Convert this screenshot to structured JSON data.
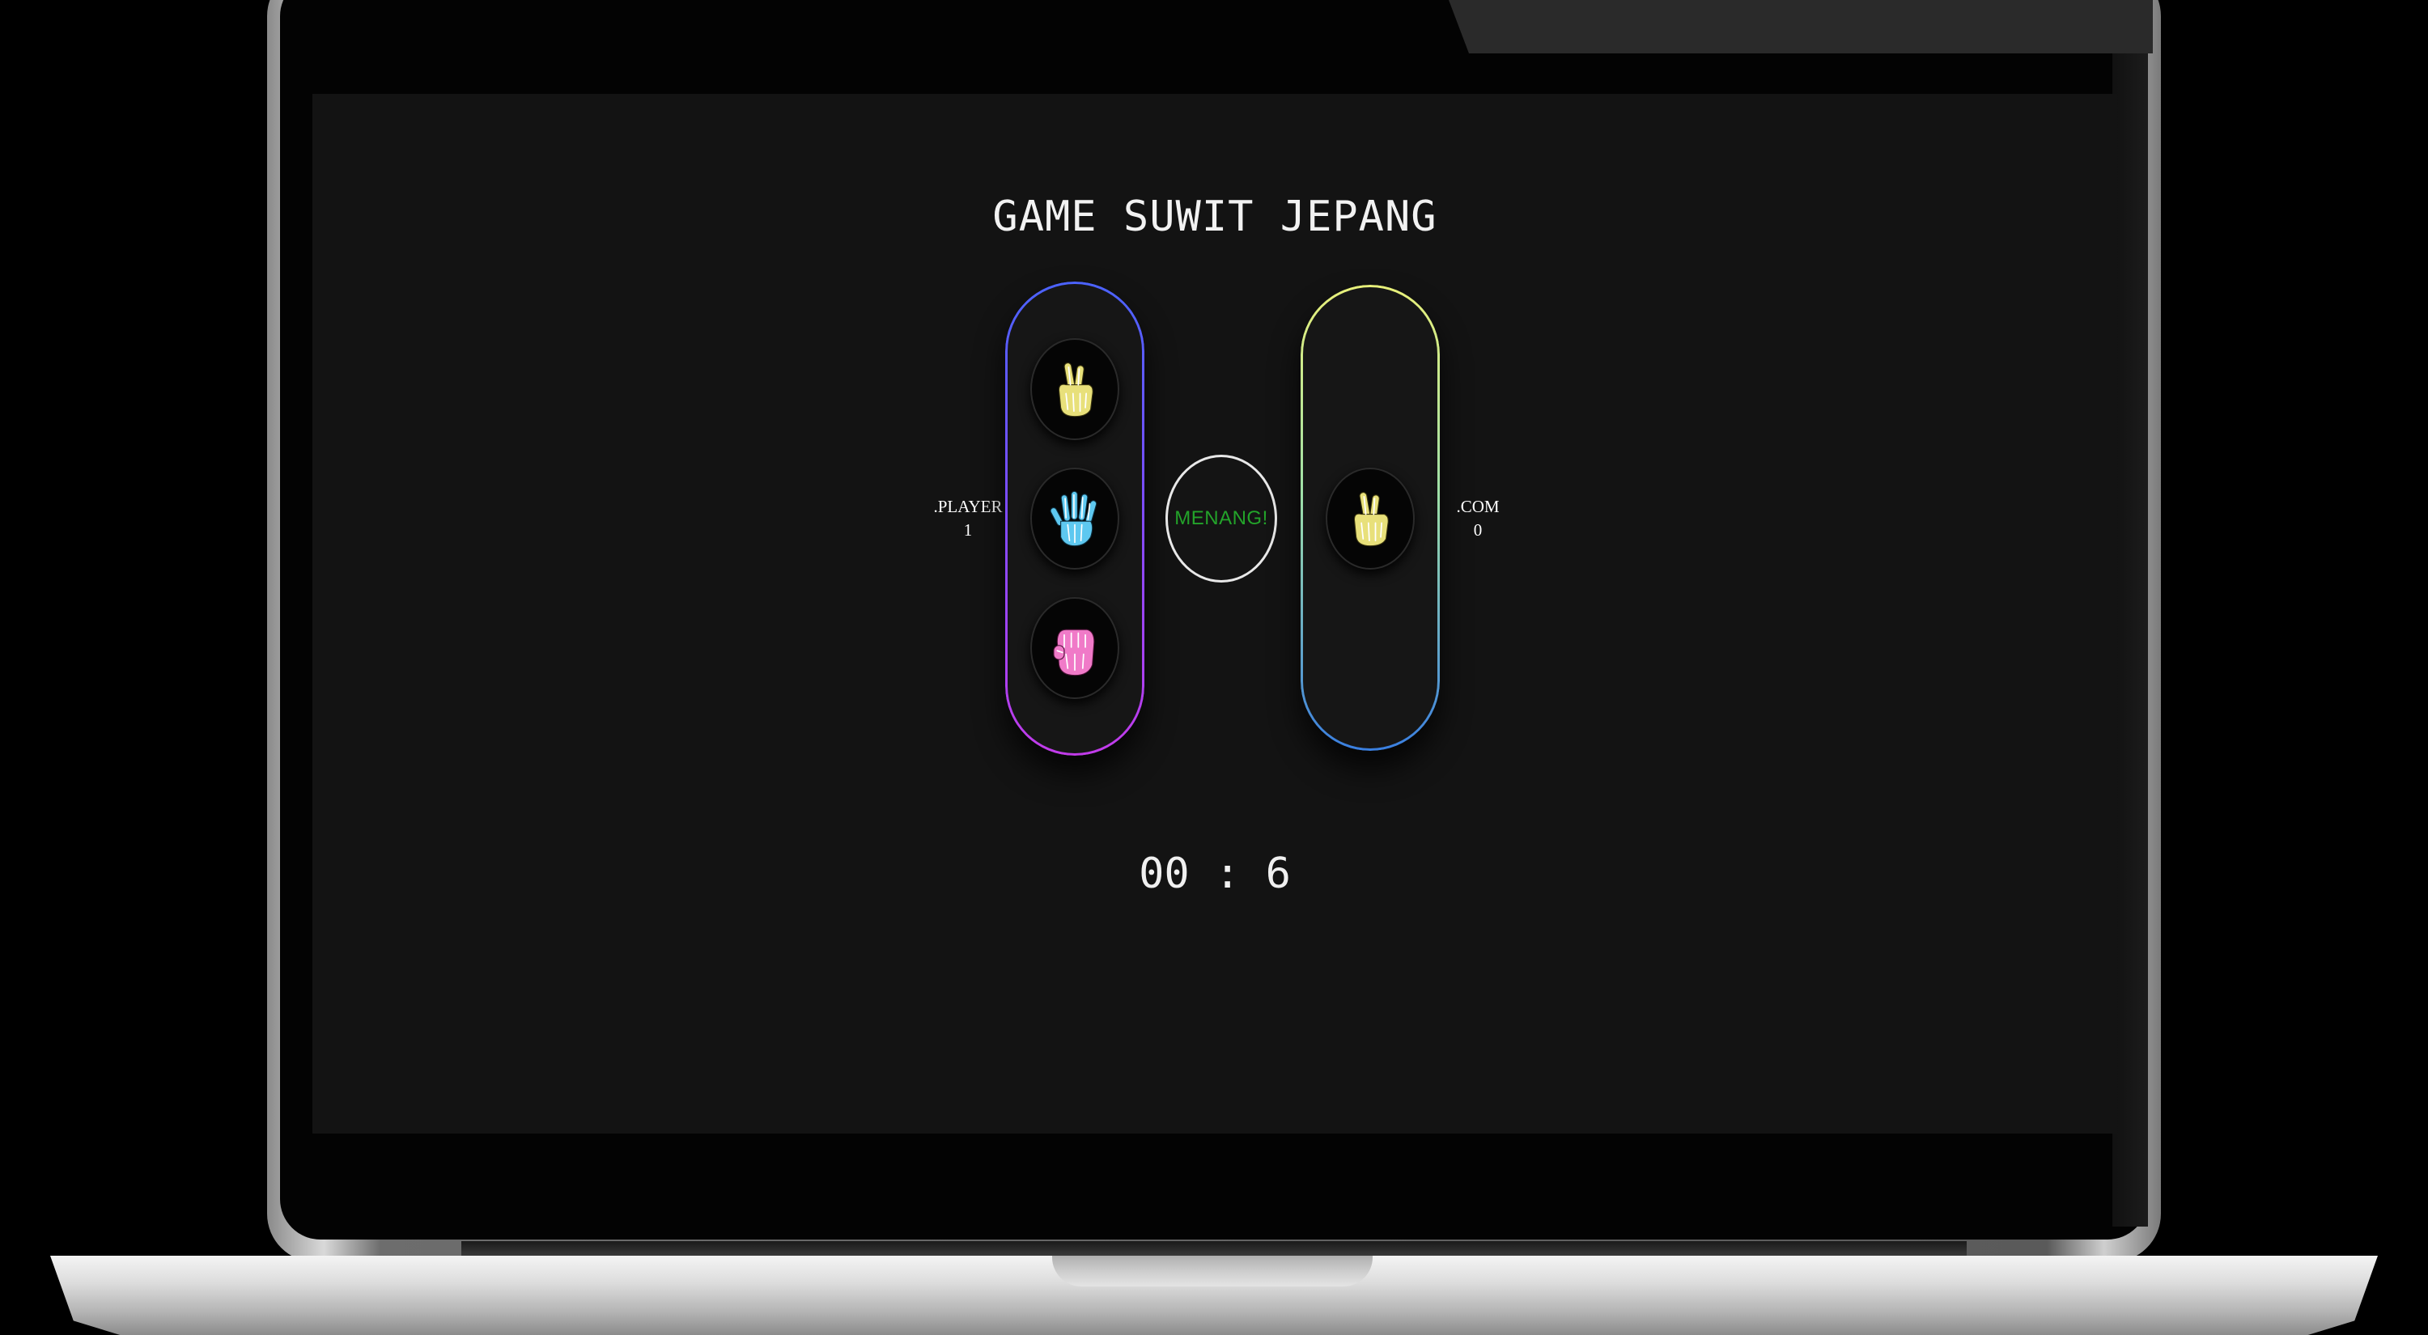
{
  "game": {
    "title": "GAME SUWIT JEPANG",
    "timer": "00 : 6",
    "result": "MENANG!"
  },
  "player": {
    "name": ".PLAYER",
    "score": "1",
    "choices": [
      {
        "icon": "skeleton-peace-hand-icon",
        "color": "#e8e07a"
      },
      {
        "icon": "skeleton-open-hand-icon",
        "color": "#5ec8f0"
      },
      {
        "icon": "skeleton-fist-icon",
        "color": "#f07ac8"
      }
    ]
  },
  "com": {
    "name": ".COM",
    "score": "0",
    "choice": {
      "icon": "skeleton-peace-hand-icon",
      "color": "#e8e07a"
    }
  },
  "colors": {
    "result_text": "#23a32a",
    "screen_background": "#131313"
  }
}
